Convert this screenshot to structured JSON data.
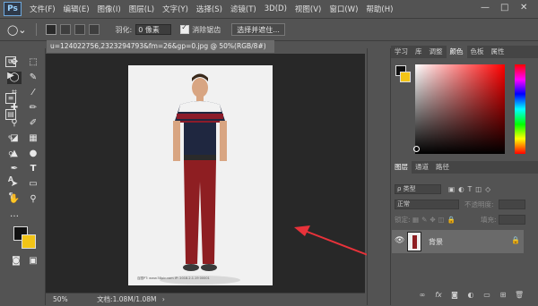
{
  "app": {
    "logo": "Ps"
  },
  "menu": [
    "文件(F)",
    "编辑(E)",
    "图像(I)",
    "图层(L)",
    "文字(Y)",
    "选择(S)",
    "滤镜(T)",
    "3D(D)",
    "视图(V)",
    "窗口(W)",
    "帮助(H)"
  ],
  "window_controls": {
    "minimize": "—",
    "maximize": "□",
    "close": "✕"
  },
  "options": {
    "feather_label": "羽化:",
    "feather_value": "0 像素",
    "antialias_label": "消除锯齿",
    "select_mask_label": "选择并遮住..."
  },
  "document": {
    "tab_title": "u=124022756,2323294793&fm=26&gp=0.jpg @ 50%(RGB/8#)",
    "tab_close": "×",
    "zoom": "50%",
    "doc_info": "文档:1.08M/1.08M",
    "watermark": "百图PT:  www.58pic.com    IP: 2018-2.1.19  00001"
  },
  "panels": {
    "top_tabs": [
      "学习",
      "库",
      "调整",
      "颜色",
      "色板",
      "属性"
    ],
    "active_top_tab": "颜色",
    "layer_tabs": [
      "图层",
      "通道",
      "路径"
    ],
    "filter_placeholder": "ρ 类型",
    "blend_mode": "正常",
    "opacity_label": "不透明度:",
    "lock_label": "锁定:",
    "fill_label": "填充:",
    "layer_name": "背景"
  },
  "colors": {
    "foreground": "#111111",
    "background": "#f2c417",
    "accent_arrow": "#e8323a"
  }
}
